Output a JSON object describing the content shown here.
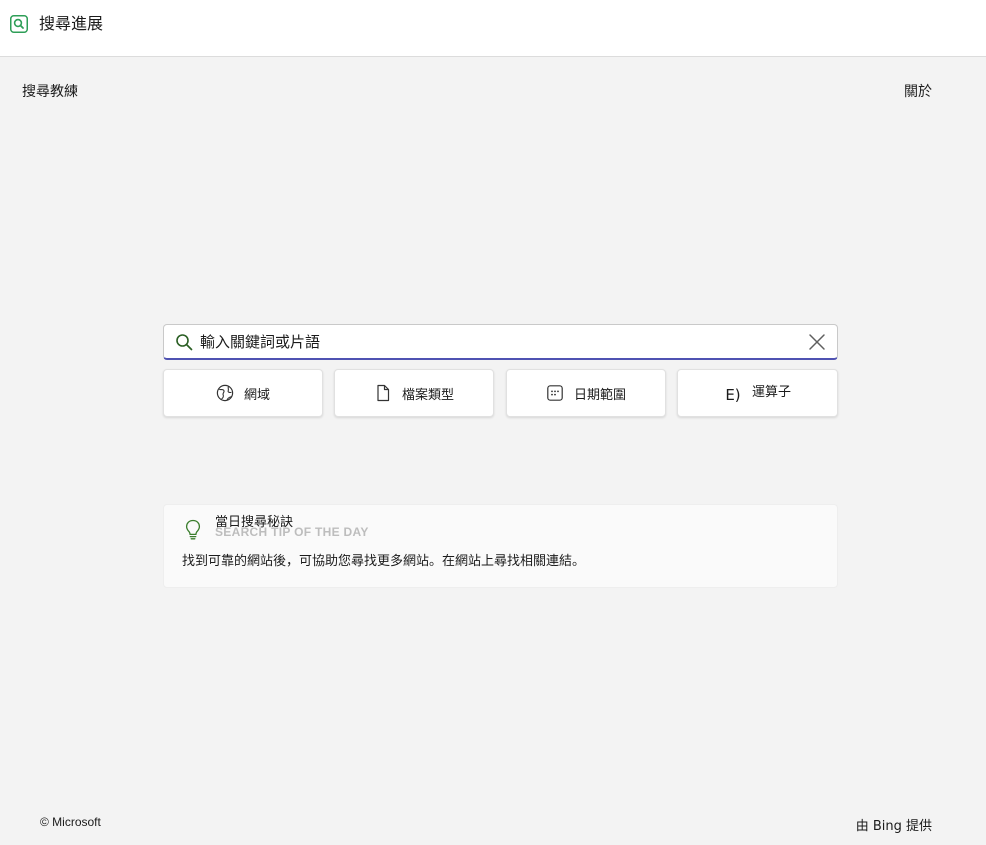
{
  "app": {
    "title": "搜尋進展",
    "icon": "search-app-icon",
    "accent_color": "#2e9e57"
  },
  "nav": {
    "left_label": "搜尋教練",
    "right_label": "關於"
  },
  "search": {
    "placeholder": "輸入關鍵詞或片語",
    "value": "",
    "underline_color": "#4f52b2"
  },
  "filters": [
    {
      "label": "網域",
      "icon": "globe-icon"
    },
    {
      "label": "檔案類型",
      "icon": "document-icon"
    },
    {
      "label": "日期範圍",
      "icon": "calendar-icon"
    },
    {
      "label": "運算子",
      "icon": "operator-icon",
      "glyph": "E)"
    }
  ],
  "tip": {
    "ghost_label": "SEARCH TIP OF THE DAY",
    "heading": "當日搜尋秘訣",
    "text": "找到可靠的網站後，可協助您尋找更多網站。在網站上尋找相關連結。",
    "icon": "lightbulb-icon",
    "icon_color": "#3a7d2c"
  },
  "footer": {
    "copyright": "© Microsoft",
    "powered_by": "由 Bing 提供"
  }
}
